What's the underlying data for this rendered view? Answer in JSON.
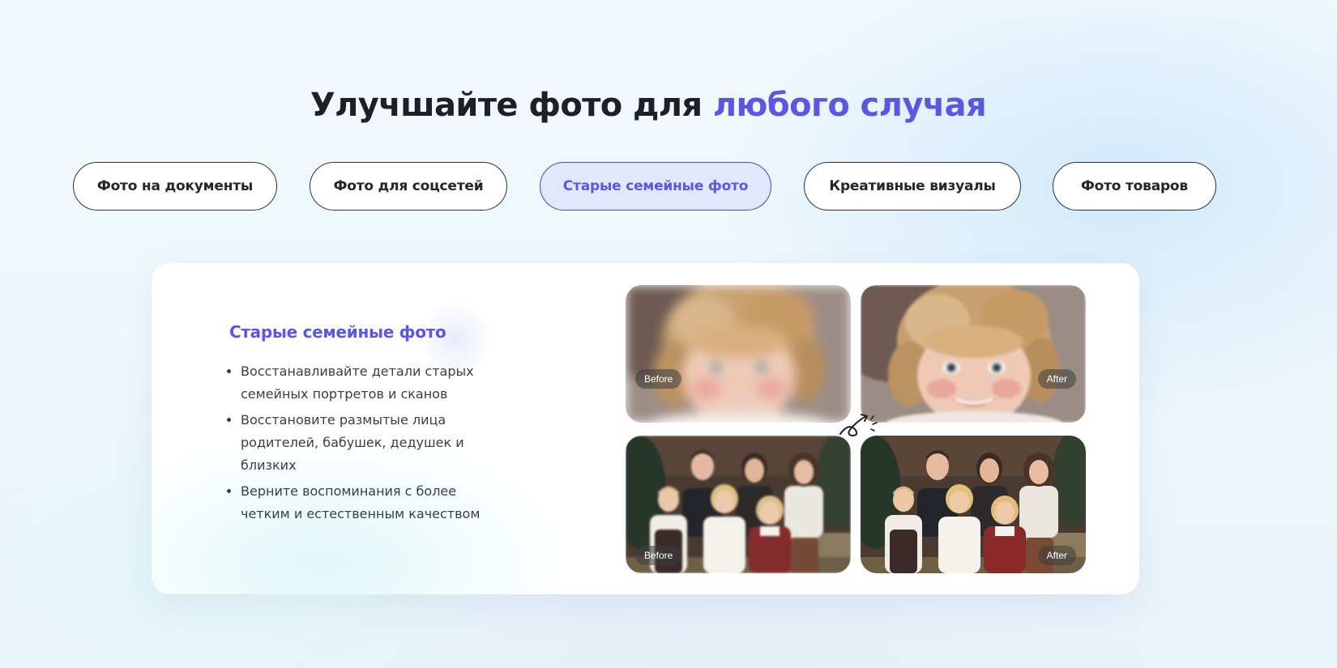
{
  "heading": {
    "main": "Улучшайте фото для ",
    "accent": "любого случая",
    "accent_color": "#5b57e3"
  },
  "tabs": [
    {
      "label": "Фото на документы",
      "active": false
    },
    {
      "label": "Фото для соцсетей",
      "active": false
    },
    {
      "label": "Старые семейные фото",
      "active": true
    },
    {
      "label": "Креативные визуалы",
      "active": false
    },
    {
      "label": "Фото товаров",
      "active": false
    }
  ],
  "card": {
    "title": "Старые семейные фото",
    "bullets": [
      "Восстанавливайте детали старых семейных портретов и сканов",
      "Восстановите размытые лица родителей, бабушек, дедушек и близких",
      "Верните воспоминания с более четким и естественным качеством"
    ]
  },
  "comparisons": [
    {
      "subject": "baby-portrait",
      "before_label": "Before",
      "after_label": "After"
    },
    {
      "subject": "family-portrait",
      "before_label": "Before",
      "after_label": "After"
    }
  ],
  "icons": {
    "arrow": "curly-arrow-icon"
  }
}
